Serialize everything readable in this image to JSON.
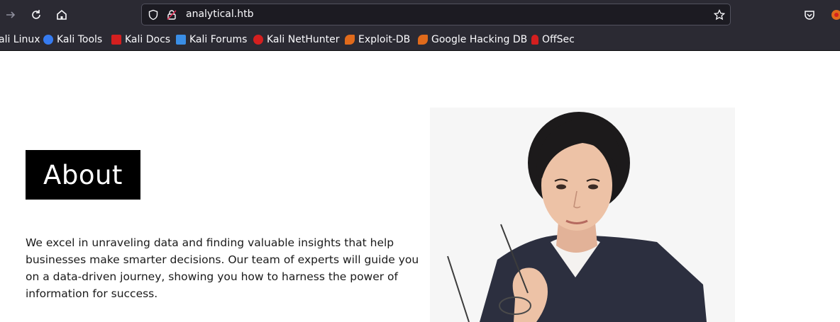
{
  "browser": {
    "url": "analytical.htb",
    "bookmarks": [
      {
        "label": "ali Linux",
        "icon": "kali-icon",
        "color": "#367bf0"
      },
      {
        "label": "Kali Tools",
        "icon": "kali-tools-icon",
        "color": "#367bf0"
      },
      {
        "label": "Kali Docs",
        "icon": "kali-docs-icon",
        "color": "#d41f1f"
      },
      {
        "label": "Kali Forums",
        "icon": "kali-forums-icon",
        "color": "#3a8ee6"
      },
      {
        "label": "Kali NetHunter",
        "icon": "kali-nethunter-icon",
        "color": "#d41f1f"
      },
      {
        "label": "Exploit-DB",
        "icon": "exploit-db-icon",
        "color": "#e06a1b"
      },
      {
        "label": "Google Hacking DB",
        "icon": "ghdb-icon",
        "color": "#e06a1b"
      },
      {
        "label": "OffSec",
        "icon": "offsec-icon",
        "color": "#d41f1f"
      }
    ]
  },
  "about": {
    "title": "About",
    "text": "We excel in unraveling data and finding valuable insights that help businesses make smarter decisions. Our team of experts will guide you on a data-driven journey, showing you how to harness the power of information for success."
  },
  "photo": {
    "subject": "woman holding glasses"
  }
}
